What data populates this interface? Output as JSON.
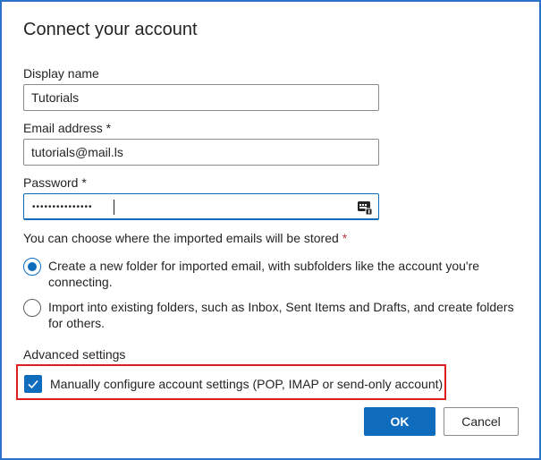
{
  "dialog": {
    "title": "Connect your account"
  },
  "display_name": {
    "label": "Display name",
    "value": "Tutorials"
  },
  "email": {
    "label": "Email address",
    "required_marker": "*",
    "value": "tutorials@mail.ls"
  },
  "password": {
    "label": "Password",
    "required_marker": "*",
    "masked_value": "•••••••••••••••",
    "reveal_icon": "password-reveal-icon"
  },
  "storage": {
    "label": "You can choose where the imported emails will be stored",
    "required_marker": "*",
    "options": [
      {
        "label": "Create a new folder for imported email, with subfolders like the account you're connecting.",
        "selected": true
      },
      {
        "label": "Import into existing folders, such as Inbox, Sent Items and Drafts, and create folders for others.",
        "selected": false
      }
    ]
  },
  "advanced": {
    "label": "Advanced settings",
    "manual_config_label": "Manually configure account settings (POP, IMAP or send-only account)",
    "manual_config_checked": true
  },
  "buttons": {
    "ok_label": "OK",
    "cancel_label": "Cancel"
  },
  "colors": {
    "accent": "#0f6cbd",
    "window_border": "#2b73c9",
    "highlight": "#e02020",
    "required": "#c4314b"
  }
}
